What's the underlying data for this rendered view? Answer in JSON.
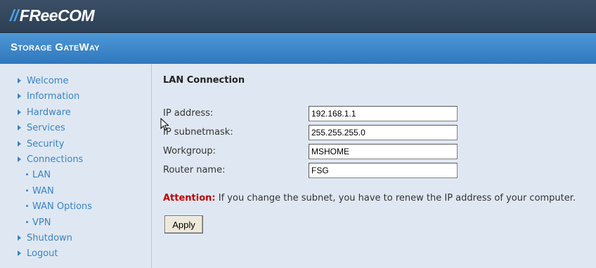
{
  "header": {
    "logo_slashes": "//",
    "logo_text": "FReeCOM",
    "subtitle": "Storage GateWay"
  },
  "sidebar": {
    "items": [
      {
        "label": "Welcome",
        "level": "main"
      },
      {
        "label": "Information",
        "level": "main"
      },
      {
        "label": "Hardware",
        "level": "main"
      },
      {
        "label": "Services",
        "level": "main"
      },
      {
        "label": "Security",
        "level": "main"
      },
      {
        "label": "Connections",
        "level": "main"
      },
      {
        "label": "LAN",
        "level": "sub"
      },
      {
        "label": "WAN",
        "level": "sub"
      },
      {
        "label": "WAN Options",
        "level": "sub"
      },
      {
        "label": "VPN",
        "level": "sub"
      },
      {
        "label": "Shutdown",
        "level": "main"
      },
      {
        "label": "Logout",
        "level": "main"
      }
    ]
  },
  "main": {
    "title": "LAN Connection",
    "fields": [
      {
        "label": "IP address:",
        "value": "192.168.1.1"
      },
      {
        "label": "IP subnetmask:",
        "value": "255.255.255.0"
      },
      {
        "label": "Workgroup:",
        "value": "MSHOME"
      },
      {
        "label": "Router name:",
        "value": "FSG"
      }
    ],
    "attention_label": "Attention:",
    "attention_text": " If you change the subnet, you have to renew the IP address of your computer.",
    "apply_label": "Apply"
  },
  "colors": {
    "header_dark": "#2c3f55",
    "header_blue": "#3a87c9",
    "link": "#3a83c8",
    "content_bg": "#dfe8f2",
    "attention": "#c40000"
  }
}
